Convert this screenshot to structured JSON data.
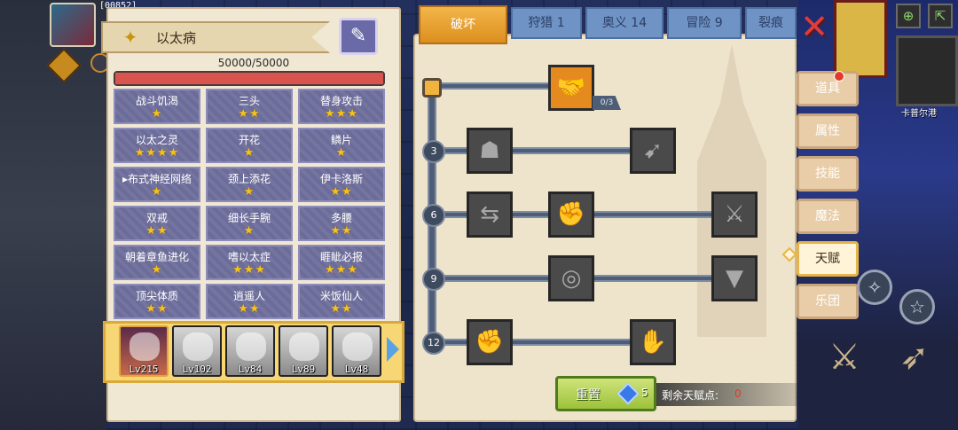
{
  "character": {
    "name": "以太病",
    "hp_text": "50000/50000",
    "hp_fraction": 1.0,
    "level_top": "[00852]"
  },
  "traits": [
    {
      "name": "战斗饥渴",
      "stars": "★"
    },
    {
      "name": "三头",
      "stars": "★★"
    },
    {
      "name": "替身攻击",
      "stars": "★★★"
    },
    {
      "name": "以太之灵",
      "stars": "★★★★"
    },
    {
      "name": "开花",
      "stars": "★"
    },
    {
      "name": "鳞片",
      "stars": "★"
    },
    {
      "name": "▸布式神经网络",
      "stars": "★"
    },
    {
      "name": "颈上添花",
      "stars": "★"
    },
    {
      "name": "伊卡洛斯",
      "stars": "★★"
    },
    {
      "name": "双戒",
      "stars": "★★"
    },
    {
      "name": "细长手腕",
      "stars": "★"
    },
    {
      "name": "多腰",
      "stars": "★★"
    },
    {
      "name": "朝着章鱼进化",
      "stars": "★"
    },
    {
      "name": "嗜以太症",
      "stars": "★★★"
    },
    {
      "name": "睚眦必报",
      "stars": "★★★"
    },
    {
      "name": "顶尖体质",
      "stars": "★★"
    },
    {
      "name": "逍遥人",
      "stars": "★★"
    },
    {
      "name": "米饭仙人",
      "stars": "★★"
    }
  ],
  "heroes": [
    {
      "level": "Lv215",
      "active": true
    },
    {
      "level": "Lv102",
      "active": false
    },
    {
      "level": "Lv84",
      "active": false
    },
    {
      "level": "Lv89",
      "active": false
    },
    {
      "level": "Lv48",
      "active": false
    }
  ],
  "tabs": [
    {
      "label": "破坏",
      "active": true
    },
    {
      "label": "狩猎 1",
      "active": false
    },
    {
      "label": "奥义 14",
      "active": false
    },
    {
      "label": "冒险 9",
      "active": false
    },
    {
      "label": "裂痕",
      "active": false
    }
  ],
  "talent_tree": {
    "root_count": "0/3",
    "tiers": [
      "3",
      "6",
      "9",
      "12"
    ],
    "root_icon": "handshake-icon",
    "nodes": [
      {
        "tier": "3",
        "icon": "body-silhouette-icon"
      },
      {
        "tier": "3",
        "icon": "arrow-strike-icon"
      },
      {
        "tier": "6",
        "icon": "swap-icon"
      },
      {
        "tier": "6",
        "icon": "fist-punch-icon"
      },
      {
        "tier": "6",
        "icon": "slash-icon"
      },
      {
        "tier": "9",
        "icon": "ripple-icon"
      },
      {
        "tier": "9",
        "icon": "bat-icon"
      },
      {
        "tier": "12",
        "icon": "raised-fist-icon"
      },
      {
        "tier": "12",
        "icon": "open-hand-icon"
      }
    ]
  },
  "reset": {
    "label": "重置",
    "gem_cost": "5"
  },
  "talent_points": {
    "label": "剩余天赋点:",
    "value": "0"
  },
  "side_menu": [
    {
      "label": "道具",
      "active": false
    },
    {
      "label": "属性",
      "active": false
    },
    {
      "label": "技能",
      "active": false
    },
    {
      "label": "魔法",
      "active": false
    },
    {
      "label": "天赋",
      "active": true
    },
    {
      "label": "乐团",
      "active": false
    }
  ],
  "map": {
    "town_label": "卡普尔港"
  },
  "colors": {
    "hp": "#d9534f",
    "active_tab": "#dc8f1e",
    "tab": "#6e93c4",
    "trait": "#6c6c9a",
    "node_lit": "#e58a1e",
    "points_value": "#e43a2a"
  }
}
